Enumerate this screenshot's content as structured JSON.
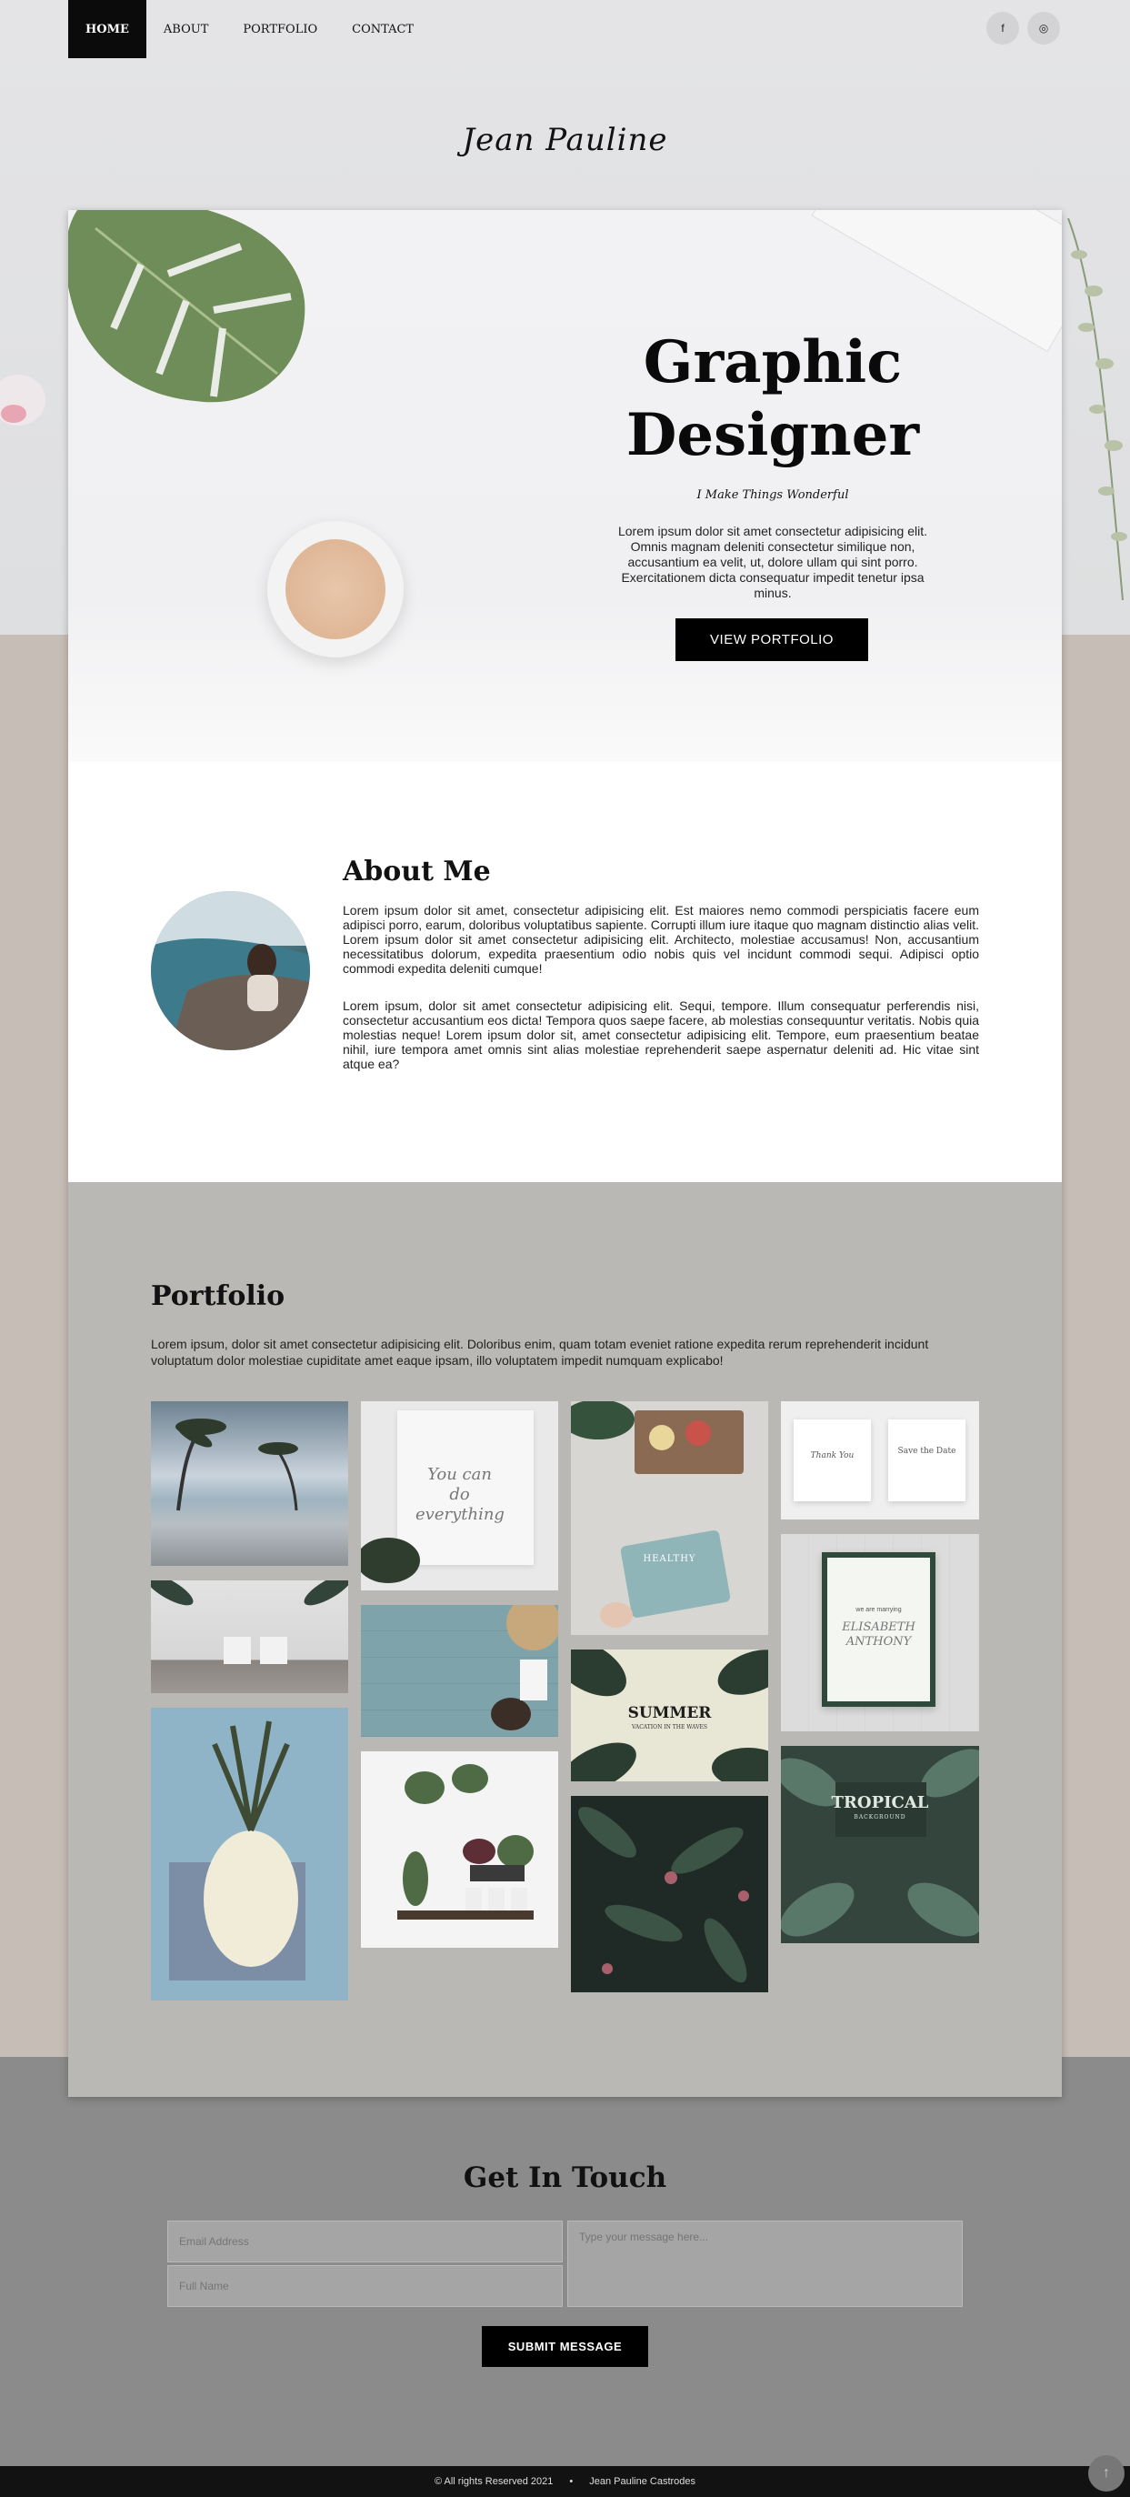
{
  "nav": {
    "items": [
      {
        "label": "HOME",
        "active": true
      },
      {
        "label": "ABOUT",
        "active": false
      },
      {
        "label": "PORTFOLIO",
        "active": false
      },
      {
        "label": "CONTACT",
        "active": false
      }
    ],
    "social": [
      {
        "icon": "facebook-icon",
        "glyph": "f"
      },
      {
        "icon": "instagram-icon",
        "glyph": "◎"
      }
    ]
  },
  "brand": "Jean Pauline",
  "hero": {
    "title_line1": "Graphic",
    "title_line2": "Designer",
    "tagline": "I Make Things Wonderful",
    "text": "Lorem ipsum dolor sit amet consectetur adipisicing elit. Omnis magnam deleniti consectetur similique non, accusantium ea velit, ut, dolore ullam qui sint porro. Exercitationem dicta consequatur impedit tenetur ipsa minus.",
    "button": "VIEW PORTFOLIO"
  },
  "about": {
    "title": "About Me",
    "p1": "Lorem ipsum dolor sit amet, consectetur adipisicing elit. Est maiores nemo commodi perspiciatis facere eum adipisci porro, earum, doloribus voluptatibus sapiente. Corrupti illum iure itaque quo magnam distinctio alias velit. Lorem ipsum dolor sit amet consectetur adipisicing elit. Architecto, molestiae accusamus! Non, accusantium necessitatibus dolorum, expedita praesentium odio nobis quis vel incidunt commodi sequi. Adipisci optio commodi expedita deleniti cumque!",
    "p2": "Lorem ipsum, dolor sit amet consectetur adipisicing elit. Sequi, tempore. Illum consequatur perferendis nisi, consectetur accusantium eos dicta! Tempora quos saepe facere, ab molestias consequuntur veritatis. Nobis quia molestias neque! Lorem ipsum dolor sit, amet consectetur adipisicing elit. Tempore, eum praesentium beatae nihil, iure tempora amet omnis sint alias molestiae reprehenderit saepe aspernatur deleniti ad. Hic vitae sint atque ea?"
  },
  "portfolio": {
    "title": "Portfolio",
    "intro": "Lorem ipsum, dolor sit amet consectetur adipisicing elit. Doloribus enim, quam totam eveniet ratione expedita rerum reprehenderit incidunt voluptatum dolor molestiae cupiditate amet eaque ipsam, illo voluptatem impedit numquam explicabo!",
    "tile_text": {
      "youcan": "You can do everything",
      "healthy": "HEALTHY",
      "summer": "SUMMER",
      "summer_sub": "VACATION IN THE WAVES",
      "thankyou": "Thank You",
      "savedate": "Save the Date",
      "invite_pre": "we are marrying",
      "invite_name": "ELISABETH ANTHONY",
      "tropical": "TROPICAL",
      "tropical_sub": "BACKGROUND"
    }
  },
  "contact": {
    "title": "Get In Touch",
    "email_placeholder": "Email Address",
    "name_placeholder": "Full Name",
    "message_placeholder": "Type your message here...",
    "submit": "SUBMIT MESSAGE"
  },
  "footer": {
    "rights": "© All rights Reserved 2021",
    "separator": "•",
    "owner": "Jean Pauline Castrodes"
  },
  "totop_icon": "arrow-up-icon"
}
